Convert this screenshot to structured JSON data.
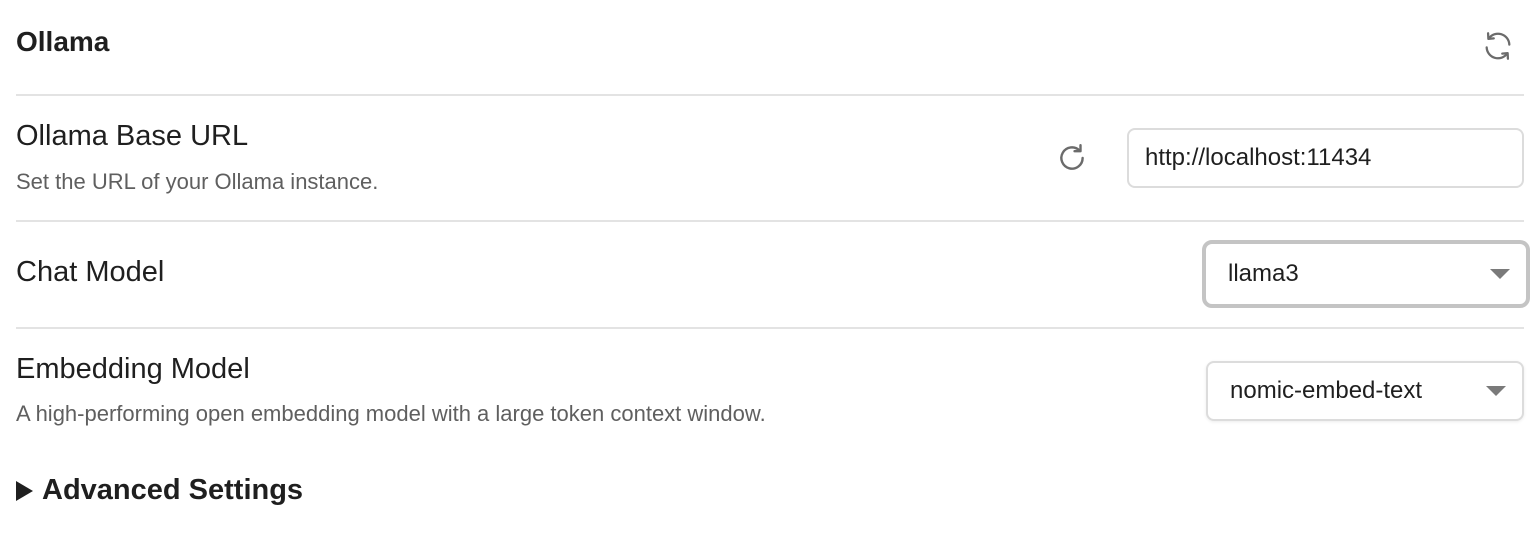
{
  "section": {
    "title": "Ollama",
    "sync_icon": "sync-arrows-icon"
  },
  "base_url": {
    "label": "Ollama Base URL",
    "description": "Set the URL of your Ollama instance.",
    "value": "http://localhost:11434",
    "reset_icon": "refresh-icon"
  },
  "chat_model": {
    "label": "Chat Model",
    "selected": "llama3",
    "caret_icon": "dropdown-caret-icon"
  },
  "embedding_model": {
    "label": "Embedding Model",
    "description": "A high-performing open embedding model with a large token context window.",
    "selected": "nomic-embed-text",
    "caret_icon": "dropdown-caret-icon"
  },
  "advanced": {
    "label": "Advanced Settings",
    "expand_icon": "disclosure-triangle-icon"
  },
  "colors": {
    "text": "#1f1f1f",
    "muted": "#5f5f5f",
    "divider": "#e3e3e3",
    "input_border": "#dcdcdc",
    "focused_select_border": "#c4c4c4",
    "icon": "#6b6b6b"
  }
}
